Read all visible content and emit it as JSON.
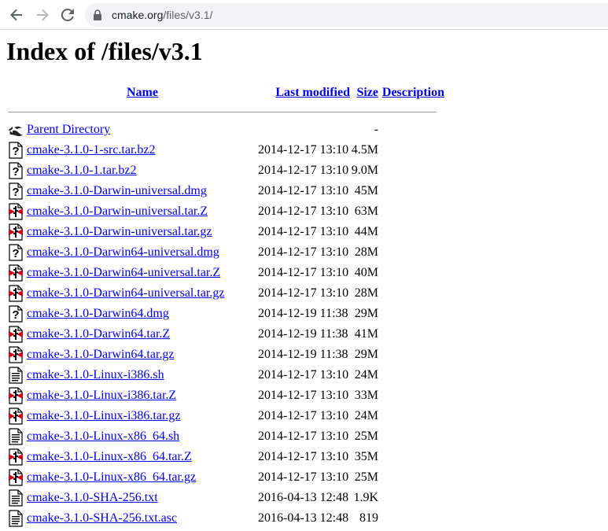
{
  "browser": {
    "url_host": "cmake.org",
    "url_path": "/files/v3.1/"
  },
  "page": {
    "title": "Index of /files/v3.1"
  },
  "table": {
    "headers": {
      "name": "Name",
      "last_modified": "Last modified",
      "size": "Size",
      "description": "Description"
    },
    "rows": [
      {
        "icon": "parent-directory-icon",
        "name": "Parent Directory",
        "date": "",
        "size": "-"
      },
      {
        "icon": "unknown-file-icon",
        "name": "cmake-3.1.0-1-src.tar.bz2",
        "date": "2014-12-17 13:10",
        "size": "4.5M"
      },
      {
        "icon": "unknown-file-icon",
        "name": "cmake-3.1.0-1.tar.bz2",
        "date": "2014-12-17 13:10",
        "size": "9.0M"
      },
      {
        "icon": "unknown-file-icon",
        "name": "cmake-3.1.0-Darwin-universal.dmg",
        "date": "2014-12-17 13:10",
        "size": "45M"
      },
      {
        "icon": "compressed-file-icon",
        "name": "cmake-3.1.0-Darwin-universal.tar.Z",
        "date": "2014-12-17 13:10",
        "size": "63M"
      },
      {
        "icon": "compressed-file-icon",
        "name": "cmake-3.1.0-Darwin-universal.tar.gz",
        "date": "2014-12-17 13:10",
        "size": "44M"
      },
      {
        "icon": "unknown-file-icon",
        "name": "cmake-3.1.0-Darwin64-universal.dmg",
        "date": "2014-12-17 13:10",
        "size": "28M"
      },
      {
        "icon": "compressed-file-icon",
        "name": "cmake-3.1.0-Darwin64-universal.tar.Z",
        "date": "2014-12-17 13:10",
        "size": "40M"
      },
      {
        "icon": "compressed-file-icon",
        "name": "cmake-3.1.0-Darwin64-universal.tar.gz",
        "date": "2014-12-17 13:10",
        "size": "28M"
      },
      {
        "icon": "unknown-file-icon",
        "name": "cmake-3.1.0-Darwin64.dmg",
        "date": "2014-12-19 11:38",
        "size": "29M"
      },
      {
        "icon": "compressed-file-icon",
        "name": "cmake-3.1.0-Darwin64.tar.Z",
        "date": "2014-12-19 11:38",
        "size": "41M"
      },
      {
        "icon": "compressed-file-icon",
        "name": "cmake-3.1.0-Darwin64.tar.gz",
        "date": "2014-12-19 11:38",
        "size": "29M"
      },
      {
        "icon": "text-file-icon",
        "name": "cmake-3.1.0-Linux-i386.sh",
        "date": "2014-12-17 13:10",
        "size": "24M"
      },
      {
        "icon": "compressed-file-icon",
        "name": "cmake-3.1.0-Linux-i386.tar.Z",
        "date": "2014-12-17 13:10",
        "size": "33M"
      },
      {
        "icon": "compressed-file-icon",
        "name": "cmake-3.1.0-Linux-i386.tar.gz",
        "date": "2014-12-17 13:10",
        "size": "24M"
      },
      {
        "icon": "text-file-icon",
        "name": "cmake-3.1.0-Linux-x86_64.sh",
        "date": "2014-12-17 13:10",
        "size": "25M"
      },
      {
        "icon": "compressed-file-icon",
        "name": "cmake-3.1.0-Linux-x86_64.tar.Z",
        "date": "2014-12-17 13:10",
        "size": "35M"
      },
      {
        "icon": "compressed-file-icon",
        "name": "cmake-3.1.0-Linux-x86_64.tar.gz",
        "date": "2014-12-17 13:10",
        "size": "25M"
      },
      {
        "icon": "text-file-icon",
        "name": "cmake-3.1.0-SHA-256.txt",
        "date": "2016-04-13 12:48",
        "size": "1.9K"
      },
      {
        "icon": "text-file-icon",
        "name": "cmake-3.1.0-SHA-256.txt.asc",
        "date": "2016-04-13 12:48",
        "size": "819"
      }
    ]
  },
  "colors": {
    "link": "#0000ee",
    "omnibox_bg": "#f1f3f4",
    "archive_red": "#d0021b"
  }
}
